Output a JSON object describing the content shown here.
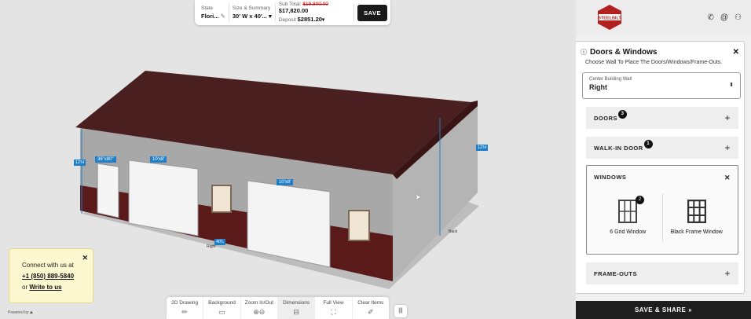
{
  "topbar": {
    "state_label": "State",
    "state_value": "Flori...",
    "size_label": "Size & Summary",
    "size_value": "30' W x 40'...",
    "subtotal_label": "Sub Total:",
    "subtotal_old": "$19,800.00",
    "subtotal_new": "$17,820.00",
    "deposit_label": "Deposit",
    "deposit_value": "$2851.20",
    "save_label": "SAVE"
  },
  "building_labels": {
    "door_walkin": "36\"x80\"",
    "door_left": "10'x8'",
    "door_mid": "10'x8'",
    "height_left": "12'H",
    "height_right": "12'H",
    "width": "40'L",
    "front": "Right",
    "back": "Back"
  },
  "connect": {
    "line1": "Connect with us at",
    "phone": "+1 (850) 889-5840",
    "or": "or",
    "write": "Write to us",
    "powered": "Powered by"
  },
  "bottombar": {
    "items": [
      "2D Drawing",
      "Background",
      "Zoom In/Out",
      "Dimensions",
      "Full View",
      "Clear Items"
    ],
    "grip": "|||"
  },
  "side": {
    "logo_text": "STEELBILT",
    "panel_title": "Doors & Windows",
    "panel_sub": "Choose Wall To Place The Doors/Windows/Frame-Outs.",
    "wall_label": "Center Building Wall",
    "wall_value": "Right",
    "doors_label": "DOORS",
    "doors_count": "3",
    "walkin_label": "WALK-IN DOOR",
    "walkin_count": "1",
    "windows_label": "WINDOWS",
    "win1_label": "6 Grid Window",
    "win1_count": "2",
    "win2_label": "Black Frame Window",
    "frameouts_label": "FRAME-OUTS",
    "save_share": "SAVE & SHARE »"
  },
  "colors": {
    "roof": "#4a1f1f",
    "wall": "#a9a9a9",
    "wainscot": "#5a1a1a",
    "label_blue": "#1f7fc7"
  }
}
